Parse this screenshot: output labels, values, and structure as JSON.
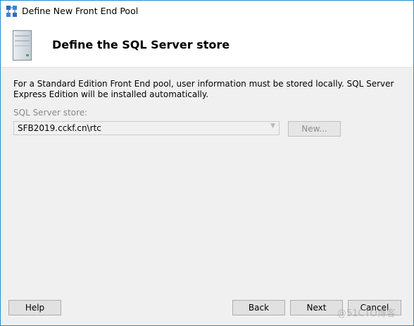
{
  "window": {
    "title": "Define New Front End Pool",
    "app_icon": "topology-builder-icon"
  },
  "header": {
    "title": "Define the SQL Server store",
    "icon": "server-icon"
  },
  "main": {
    "description": "For a Standard Edition Front End pool, user information must be stored locally.  SQL Server Express Edition will be installed automatically.",
    "sql_store_label": "SQL Server store:",
    "sql_store_value": "SFB2019.cckf.cn\\rtc",
    "new_button_label": "New..."
  },
  "footer": {
    "help_label": "Help",
    "back_label": "Back",
    "next_label": "Next",
    "cancel_label": "Cancel"
  },
  "watermark": "@51CTO博客",
  "colors": {
    "window_border": "#1e8fd6",
    "dialog_background": "#f0f0f0",
    "header_background": "#ffffff"
  }
}
